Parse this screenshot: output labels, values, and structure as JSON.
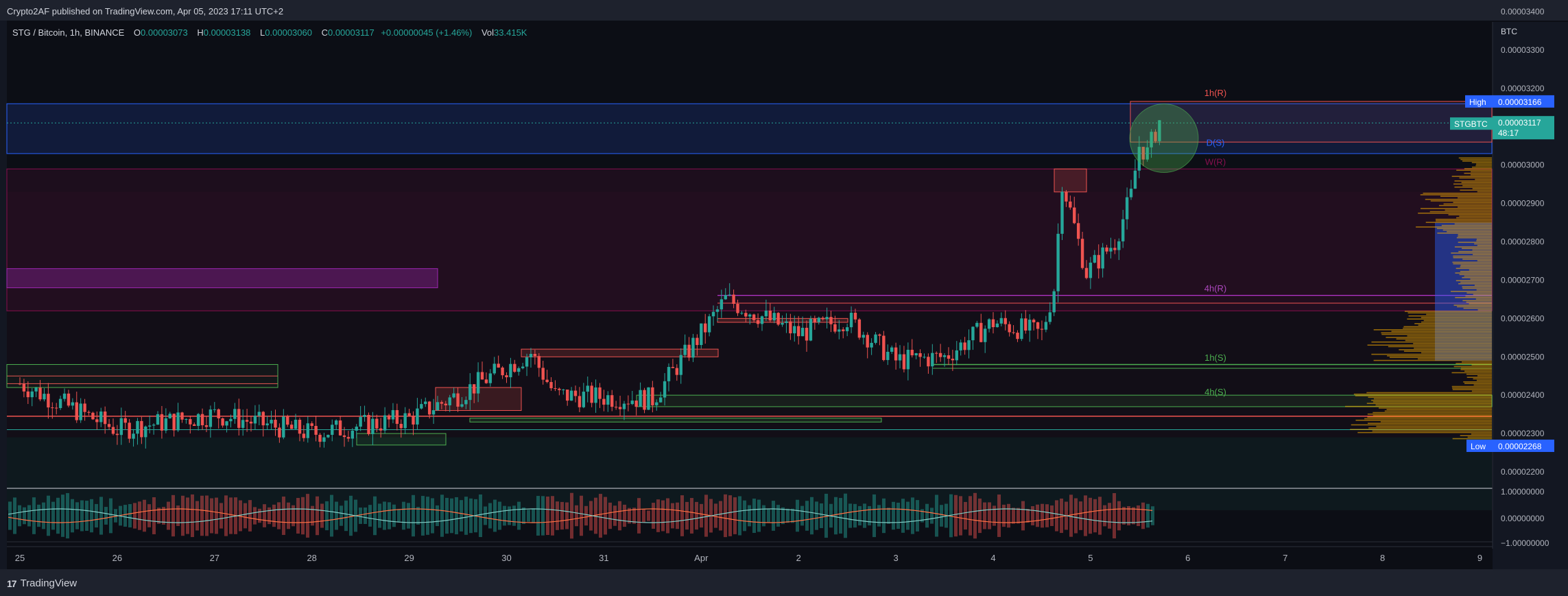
{
  "publisher_line": "Crypto2AF published on TradingView.com, Apr 05, 2023 17:11 UTC+2",
  "footer_brand": "TradingView",
  "legend": {
    "symbol": "STG / Bitcoin, 1h, BINANCE",
    "open_label": "O",
    "open": "0.00003073",
    "high_label": "H",
    "high": "0.00003138",
    "low_label": "L",
    "low": "0.00003060",
    "close_label": "C",
    "close": "0.00003117",
    "change": "+0.00000045 (+1.46%)",
    "vol_label": "Vol",
    "vol": "33.415K"
  },
  "price_axis": {
    "unit": "BTC",
    "ticks": [
      "0.00003400",
      "0.00003300",
      "0.00003200",
      "0.00003000",
      "0.00002900",
      "0.00002800",
      "0.00002700",
      "0.00002600",
      "0.00002500",
      "0.00002400",
      "0.00002300",
      "0.00002200"
    ],
    "high_tag": "High",
    "high_value": "0.00003166",
    "low_tag": "Low",
    "low_value": "0.00002268",
    "symbol_tag": "STGBTC",
    "last_value": "0.00003117",
    "countdown": "48:17"
  },
  "osc_axis": {
    "ticks": [
      "1.00000000",
      "0.00000000",
      "−1.00000000"
    ]
  },
  "time_axis": {
    "labels": [
      "25",
      "26",
      "27",
      "28",
      "29",
      "30",
      "31",
      "Apr",
      "2",
      "3",
      "4",
      "5",
      "6",
      "7",
      "8",
      "9"
    ]
  },
  "zone_labels": [
    "1h(R)",
    "D(S)",
    "W(R)",
    "4h(R)",
    "1h(S)",
    "4h(S)"
  ],
  "colors": {
    "up": "#26a69a",
    "down": "#ef5350",
    "accent": "#2962ff"
  },
  "chart_data": {
    "type": "candlestick",
    "title": "STG / Bitcoin, 1h, BINANCE",
    "ylabel": "BTC",
    "ylim": [
      2.1e-05,
      3.4e-05
    ],
    "x_range": [
      "Mar 25",
      "Apr 9"
    ],
    "grid": false,
    "high": 3.166e-05,
    "low": 2.268e-05,
    "last": 3.117e-05,
    "key_points": [
      {
        "x": "Mar 25 00:00",
        "y": 2.43e-05
      },
      {
        "x": "Mar 26 00:00",
        "y": 2.31e-05
      },
      {
        "x": "Mar 27 00:00",
        "y": 2.35e-05
      },
      {
        "x": "Mar 28 00:00",
        "y": 2.3e-05
      },
      {
        "x": "Mar 29 00:00",
        "y": 2.34e-05
      },
      {
        "x": "Mar 29 12:00",
        "y": 2.4e-05
      },
      {
        "x": "Mar 30 06:00",
        "y": 2.51e-05
      },
      {
        "x": "Mar 30 12:00",
        "y": 2.4e-05
      },
      {
        "x": "Mar 31 12:00",
        "y": 2.39e-05
      },
      {
        "x": "Apr 1 00:00",
        "y": 2.56e-05
      },
      {
        "x": "Apr 1 06:00",
        "y": 2.65e-05
      },
      {
        "x": "Apr 2 00:00",
        "y": 2.56e-05
      },
      {
        "x": "Apr 2 12:00",
        "y": 2.6e-05
      },
      {
        "x": "Apr 3 00:00",
        "y": 2.49e-05
      },
      {
        "x": "Apr 3 12:00",
        "y": 2.5e-05
      },
      {
        "x": "Apr 4 00:00",
        "y": 2.59e-05
      },
      {
        "x": "Apr 4 12:00",
        "y": 2.56e-05
      },
      {
        "x": "Apr 4 15:00",
        "y": 2.68e-05
      },
      {
        "x": "Apr 4 17:00",
        "y": 2.96e-05
      },
      {
        "x": "Apr 4 23:00",
        "y": 2.72e-05
      },
      {
        "x": "Apr 5 06:00",
        "y": 2.8e-05
      },
      {
        "x": "Apr 5 10:00",
        "y": 2.92e-05
      },
      {
        "x": "Apr 5 12:00",
        "y": 3.05e-05
      },
      {
        "x": "Apr 5 14:00",
        "y": 3.03e-05
      },
      {
        "x": "Apr 5 17:00",
        "y": 3.117e-05
      }
    ],
    "zones": [
      {
        "label": "1h(R)",
        "from": 3.06e-05,
        "to": 3.166e-05
      },
      {
        "label": "D(S)",
        "from": 3.03e-05,
        "to": 3.15e-05
      },
      {
        "label": "W(R)",
        "from": 2.62e-05,
        "to": 2.99e-05
      },
      {
        "label": "4h(R)",
        "from": 2.65e-05,
        "to": 2.66e-05
      },
      {
        "label": "1h(S)",
        "from": 2.47e-05,
        "to": 2.48e-05
      },
      {
        "label": "4h(S)",
        "from": 2.37e-05,
        "to": 2.39e-05
      }
    ]
  }
}
